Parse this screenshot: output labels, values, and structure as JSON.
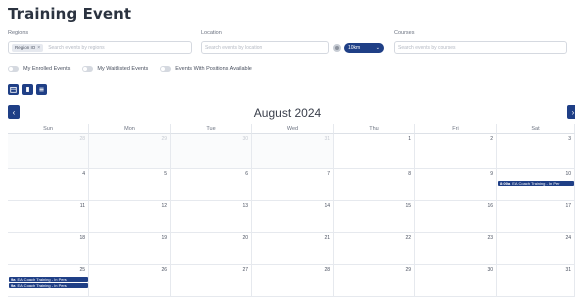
{
  "page": {
    "title": "Training Event"
  },
  "filters": {
    "regions": {
      "label": "Regions",
      "chip": "Region IO",
      "placeholder": "Search events by regions"
    },
    "location": {
      "label": "Location",
      "placeholder": "Search events by location",
      "unit": "10km"
    },
    "courses": {
      "label": "Courses",
      "placeholder": "Search events by courses"
    }
  },
  "toggles": [
    {
      "label": "My Enrolled Events",
      "on": false
    },
    {
      "label": "My Waitlisted Events",
      "on": false
    },
    {
      "label": "Events With Positions Available",
      "on": false
    }
  ],
  "view_buttons": [
    {
      "icon": "calendar-icon"
    },
    {
      "icon": "list-icon"
    },
    {
      "icon": "menu-icon"
    }
  ],
  "calendar": {
    "month_label": "August 2024",
    "nav": {
      "prev": "‹",
      "next": "›"
    },
    "weekdays": [
      "Sun",
      "Mon",
      "Tue",
      "Wed",
      "Thu",
      "Fri",
      "Sat"
    ],
    "weeks": [
      [
        {
          "d": "28",
          "other": true
        },
        {
          "d": "29",
          "other": true
        },
        {
          "d": "30",
          "other": true
        },
        {
          "d": "31",
          "other": true
        },
        {
          "d": "1"
        },
        {
          "d": "2"
        },
        {
          "d": "3"
        }
      ],
      [
        {
          "d": "4"
        },
        {
          "d": "5"
        },
        {
          "d": "6"
        },
        {
          "d": "7"
        },
        {
          "d": "8"
        },
        {
          "d": "9"
        },
        {
          "d": "10",
          "events": [
            {
              "time": "8:00a",
              "title": "EA Coach Training - In Per"
            }
          ]
        }
      ],
      [
        {
          "d": "11"
        },
        {
          "d": "12"
        },
        {
          "d": "13"
        },
        {
          "d": "14"
        },
        {
          "d": "15"
        },
        {
          "d": "16"
        },
        {
          "d": "17"
        }
      ],
      [
        {
          "d": "18"
        },
        {
          "d": "19"
        },
        {
          "d": "20"
        },
        {
          "d": "21"
        },
        {
          "d": "22"
        },
        {
          "d": "23"
        },
        {
          "d": "24"
        }
      ],
      [
        {
          "d": "25",
          "events": [
            {
              "time": "9a",
              "title": "EA Coach Training - In Pers"
            },
            {
              "time": "9a",
              "title": "EA Coach Training - In Pers"
            }
          ]
        },
        {
          "d": "26"
        },
        {
          "d": "27"
        },
        {
          "d": "28"
        },
        {
          "d": "29"
        },
        {
          "d": "30"
        },
        {
          "d": "31"
        }
      ]
    ]
  },
  "colors": {
    "primary": "#1f3f86",
    "border": "#e6e9ee"
  }
}
